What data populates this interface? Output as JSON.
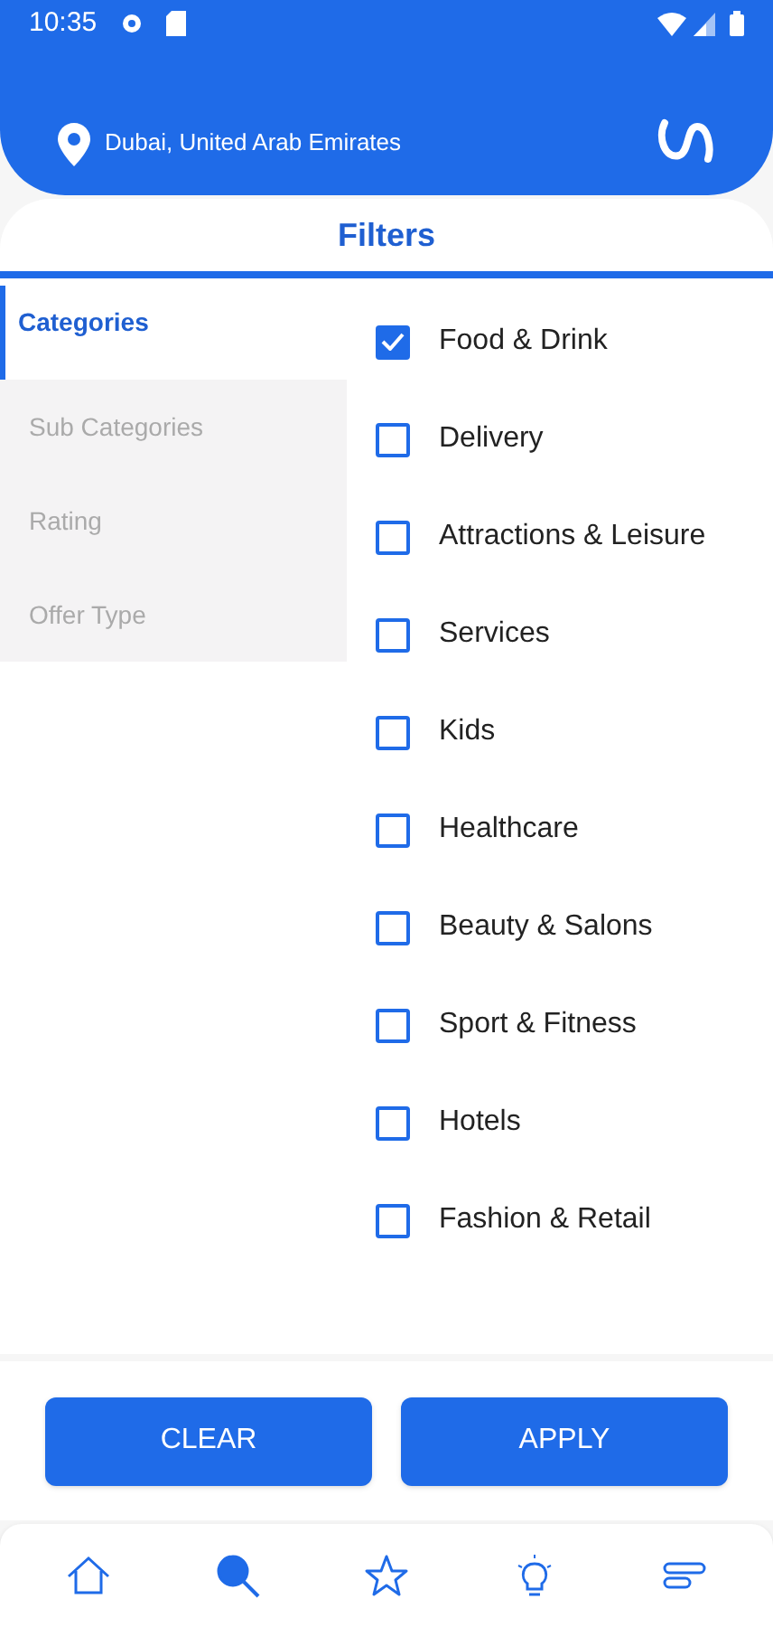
{
  "status_bar": {
    "time": "10:35"
  },
  "header": {
    "location": "Dubai, United Arab Emirates"
  },
  "title": "Filters",
  "filter_sections": [
    {
      "label": "Categories",
      "selected": true
    },
    {
      "label": "Sub Categories",
      "selected": false
    },
    {
      "label": "Rating",
      "selected": false
    },
    {
      "label": "Offer Type",
      "selected": false
    }
  ],
  "options": [
    {
      "label": "Food & Drink",
      "checked": true
    },
    {
      "label": "Delivery",
      "checked": false
    },
    {
      "label": "Attractions & Leisure",
      "checked": false
    },
    {
      "label": "Services",
      "checked": false
    },
    {
      "label": "Kids",
      "checked": false
    },
    {
      "label": "Healthcare",
      "checked": false
    },
    {
      "label": "Beauty & Salons",
      "checked": false
    },
    {
      "label": "Sport & Fitness",
      "checked": false
    },
    {
      "label": "Hotels",
      "checked": false
    },
    {
      "label": "Fashion & Retail",
      "checked": false
    }
  ],
  "buttons": [
    "CLEAR",
    "APPLY"
  ],
  "bottom_nav": [
    {
      "kind": "home",
      "selected": false
    },
    {
      "kind": "search",
      "selected": true
    },
    {
      "kind": "star",
      "selected": false
    },
    {
      "kind": "bulb",
      "selected": false
    },
    {
      "kind": "menu",
      "selected": false
    }
  ]
}
